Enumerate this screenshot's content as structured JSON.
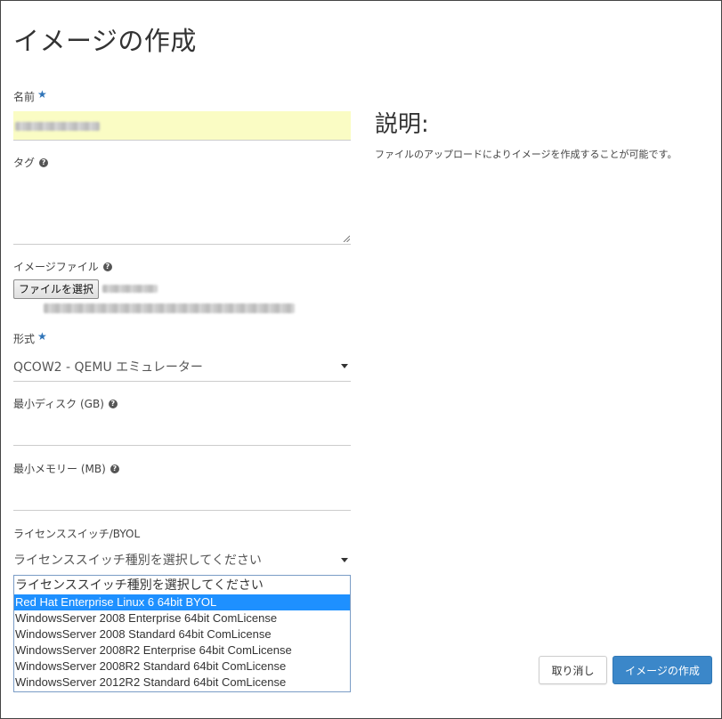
{
  "page": {
    "title": "イメージの作成"
  },
  "form": {
    "name_label": "名前",
    "required_mark": "★",
    "tag_label": "タグ",
    "image_file_label": "イメージファイル",
    "file_button_label": "ファイルを選択",
    "format_label": "形式",
    "format_value": "QCOW2 - QEMU エミュレーター",
    "min_disk_label": "最小ディスク (GB)",
    "min_memory_label": "最小メモリー (MB)",
    "license_label": "ライセンススイッチ/BYOL",
    "license_value": "ライセンススイッチ種別を選択してください",
    "license_options": [
      "ライセンススイッチ種別を選択してください",
      "Red Hat Enterprise Linux 6 64bit BYOL",
      "WindowsServer 2008 Enterprise 64bit ComLicense",
      "WindowsServer 2008 Standard 64bit ComLicense",
      "WindowsServer 2008R2 Enterprise 64bit ComLicense",
      "WindowsServer 2008R2 Standard 64bit ComLicense",
      "WindowsServer 2012R2 Standard 64bit ComLicense"
    ]
  },
  "description": {
    "title": "説明:",
    "text": "ファイルのアップロードによりイメージを作成することが可能です。"
  },
  "actions": {
    "cancel_label": "取り消し",
    "create_label": "イメージの作成"
  },
  "colors": {
    "accent": "#3b87c9",
    "required": "#2f74b8",
    "highlight": "#1e90ff",
    "autofill": "#fafcc4"
  },
  "icons": {
    "help": "help-icon",
    "caret": "chevron-down-icon",
    "resize": "resize-handle-icon"
  }
}
